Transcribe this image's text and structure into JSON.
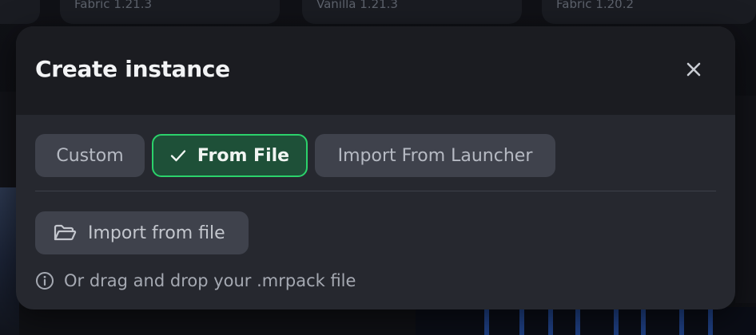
{
  "background": {
    "cards": [
      "Fabric 1.21.3",
      "Vanilla 1.21.3",
      "Fabric 1.20.2"
    ]
  },
  "modal": {
    "title": "Create instance",
    "close_icon": "close-icon",
    "tabs": [
      {
        "label": "Custom",
        "selected": false
      },
      {
        "label": "From File",
        "selected": true,
        "icon": "check-icon"
      },
      {
        "label": "Import From Launcher",
        "selected": false
      }
    ],
    "import_button": {
      "label": "Import from file",
      "icon": "folder-open-icon"
    },
    "hint": {
      "text": "Or drag and drop your .mrpack file",
      "icon": "info-icon"
    }
  },
  "colors": {
    "modal_bg": "#26282f",
    "header_bg": "#1b1c21",
    "chip_bg": "#3f424c",
    "selected_bg": "#1e5038",
    "selected_border": "#2bd26b",
    "text_primary": "#f2f3f5",
    "text_muted": "#a5a9b2"
  }
}
